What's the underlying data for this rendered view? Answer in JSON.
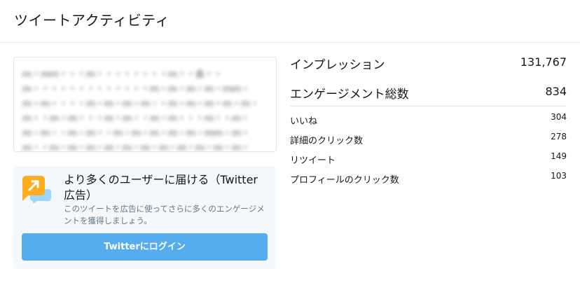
{
  "header": {
    "title": "ツイートアクティビティ"
  },
  "tweet": {
    "text": "　　　　　　　　　　　　　　　　　　　　　　　　　　　　　　　　　　　　　　　　　　　　　　　　　　　　　　　　　　　　　　　　　　　　　　　　　　　　　　　　　　　　　"
  },
  "promo": {
    "title": "より多くのユーザーに届ける（Twitter広告）",
    "description": "このツイートを広告に使ってさらに多くのエンゲージメントを獲得しましょう。",
    "button_label": "Twitterにログイン",
    "icon": "promote-arrow-icon",
    "colors": {
      "icon_yellow": "#ffad1f",
      "icon_blue": "#9fd6fb",
      "button": "#55acee",
      "panel_bg": "#f5f8fa"
    }
  },
  "stats": {
    "main": [
      {
        "label": "インプレッション",
        "value": "131,767"
      },
      {
        "label": "エンゲージメント総数",
        "value": "834"
      }
    ],
    "sub": [
      {
        "label": "いいね",
        "value": "304"
      },
      {
        "label": "詳細のクリック数",
        "value": "278"
      },
      {
        "label": "リツイート",
        "value": "149"
      },
      {
        "label": "プロフィールのクリック数",
        "value": "103"
      }
    ]
  }
}
